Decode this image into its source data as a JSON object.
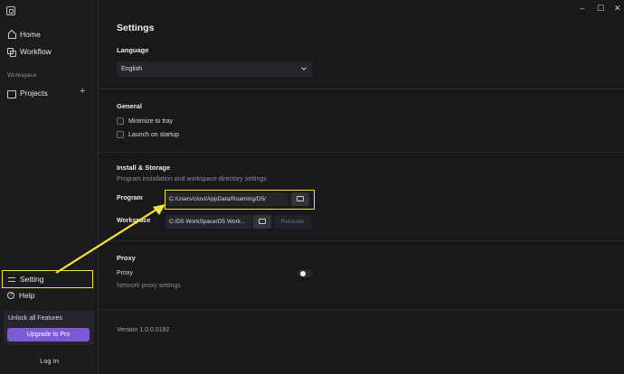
{
  "sidebar": {
    "nav": [
      {
        "label": "Home",
        "icon": "home-icon"
      },
      {
        "label": "Workflow",
        "icon": "workflow-icon"
      }
    ],
    "section_label": "Workspace",
    "projects_label": "Projects",
    "add_icon": "+",
    "setting_label": "Setting",
    "help_label": "Help",
    "unlock_text": "Unlock all Features",
    "upgrade_label": "Upgrade to Pro",
    "login_label": "Log In"
  },
  "window": {
    "minimize": "–",
    "maximize": "☐",
    "close": "✕"
  },
  "settings": {
    "title": "Settings",
    "language": {
      "heading": "Language",
      "selected": "English"
    },
    "general": {
      "heading": "General",
      "options": [
        "Minimize to tray",
        "Launch on startup"
      ]
    },
    "storage": {
      "heading": "Install & Storage",
      "description": "Program installation and workspace directory settings",
      "program_label": "Program",
      "program_path": "C:/Users/clovi/AppData/Roaming/D5/",
      "workspace_label": "Workspace",
      "workspace_path": "C:/D5 WorkSpace/D5 Work...",
      "relocate_label": "Relocate"
    },
    "proxy": {
      "heading": "Proxy",
      "label": "Proxy",
      "description": "Network proxy settings"
    },
    "version": "Version 1.0.0.0192"
  },
  "colors": {
    "accent": "#7d5ad6",
    "annotation": "#f5e43a"
  }
}
